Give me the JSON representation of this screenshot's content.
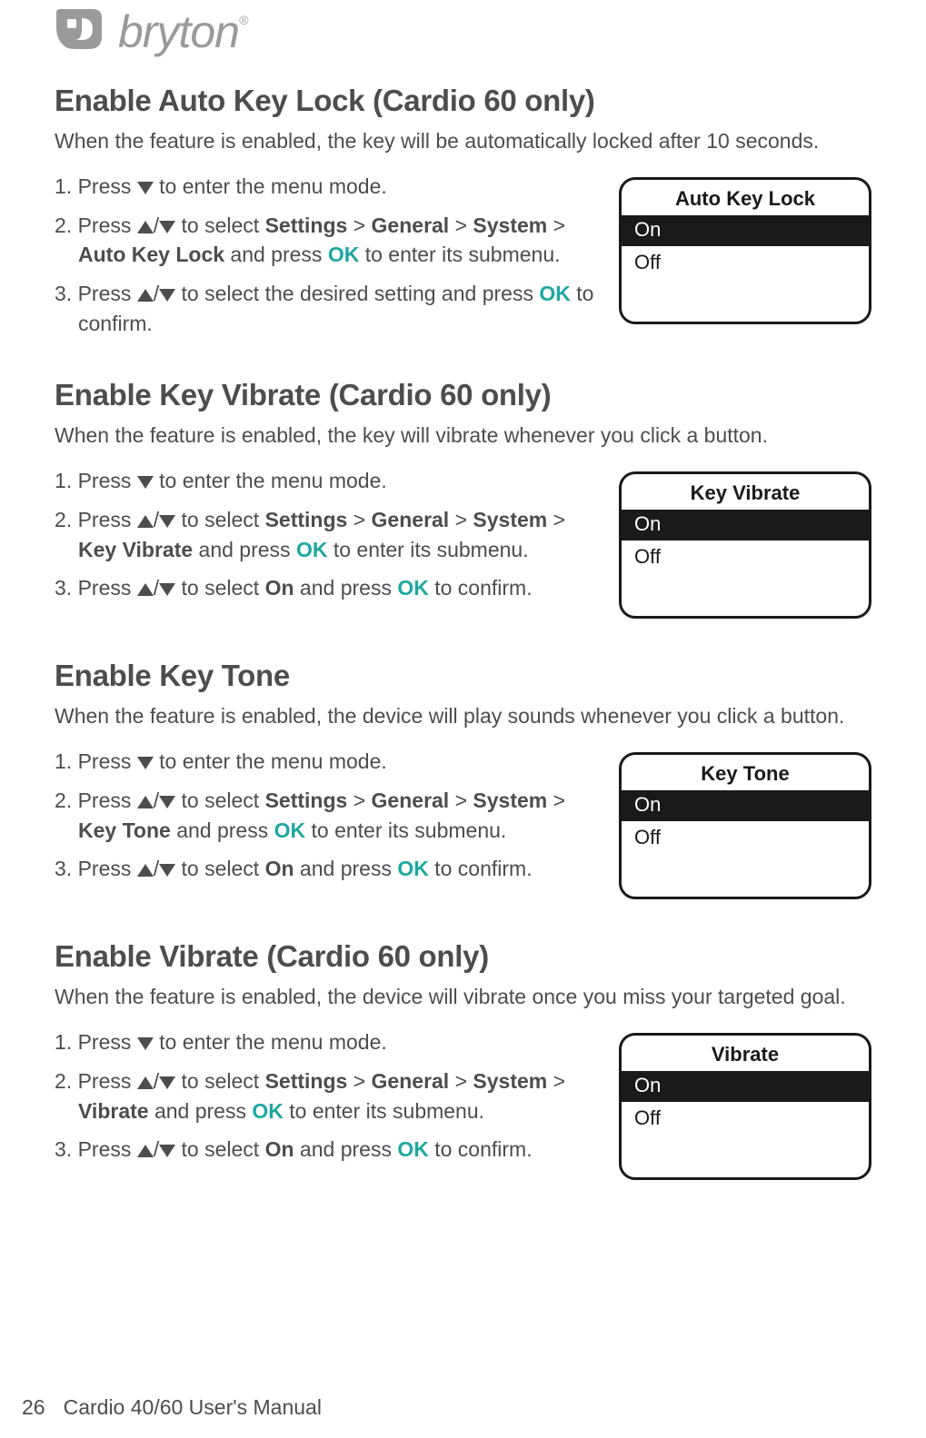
{
  "brand": "bryton",
  "sections": [
    {
      "title": "Enable Auto Key Lock (Cardio 60 only)",
      "intro": "When the feature is enabled, the key will be automatically locked after 10 seconds.",
      "device_title": "Auto Key Lock",
      "device_on": "On",
      "device_off": "Off",
      "nav_path": [
        "Settings",
        "General",
        "System",
        "Auto Key Lock"
      ],
      "step3_variant": "desired"
    },
    {
      "title": "Enable Key Vibrate (Cardio 60 only)",
      "intro": "When the feature is enabled, the key will vibrate whenever you click a button.",
      "device_title": "Key Vibrate",
      "device_on": "On",
      "device_off": "Off",
      "nav_path": [
        "Settings",
        "General",
        "System",
        "Key Vibrate"
      ],
      "step3_variant": "on"
    },
    {
      "title": "Enable Key Tone",
      "intro": "When the feature is enabled, the device will play sounds whenever you click a button.",
      "device_title": "Key Tone",
      "device_on": "On",
      "device_off": "Off",
      "nav_path": [
        "Settings",
        "General",
        "System",
        "Key Tone"
      ],
      "step3_variant": "on"
    },
    {
      "title": "Enable Vibrate (Cardio 60 only)",
      "intro": "When the feature is enabled, the device will vibrate once you miss your targeted goal.",
      "device_title": "Vibrate",
      "device_on": "On",
      "device_off": "Off",
      "nav_path": [
        "Settings",
        "General",
        "System",
        "Vibrate"
      ],
      "step3_variant": "on"
    }
  ],
  "labels": {
    "press": "Press",
    "to_enter_menu": " to enter the menu mode.",
    "to_select": " to select ",
    "and_press": " and press ",
    "to_enter_submenu": " to enter its submenu.",
    "to_confirm": " to confirm.",
    "to_select_desired": " to select the desired setting and press ",
    "to_select_on_pre": " to select ",
    "ok": "OK",
    "on_bold": "On",
    "gt": " > "
  },
  "footer": {
    "page": "26",
    "title": "Cardio 40/60 User's Manual"
  }
}
